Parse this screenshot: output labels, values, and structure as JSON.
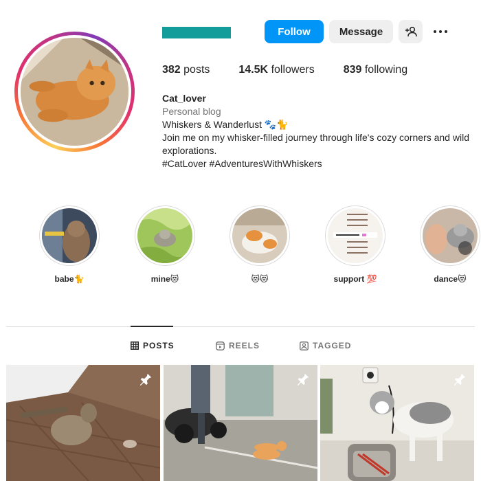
{
  "profile": {
    "follow_label": "Follow",
    "message_label": "Message",
    "posts_count": "382",
    "posts_label": "posts",
    "followers_count": "14.5K",
    "followers_label": "followers",
    "following_count": "839",
    "following_label": "following"
  },
  "bio": {
    "name": "Cat_lover",
    "category": "Personal blog",
    "line1": "Whiskers & Wanderlust 🐾🐈",
    "line2": "Join me on my whisker-filled journey through life's cozy corners and wild explorations.",
    "hashtags": "#CatLover #AdventuresWithWhiskers"
  },
  "highlights": [
    {
      "label": "babe🐈"
    },
    {
      "label": "mine😻"
    },
    {
      "label": "😻😻"
    },
    {
      "label": "support 💯"
    },
    {
      "label": "dance😻"
    }
  ],
  "tabs": [
    {
      "label": "POSTS",
      "icon": "grid-icon"
    },
    {
      "label": "REELS",
      "icon": "reels-icon"
    },
    {
      "label": "TAGGED",
      "icon": "tagged-icon"
    }
  ],
  "colors": {
    "follow_blue": "#0095f6",
    "username_bar": "#129c9a"
  }
}
